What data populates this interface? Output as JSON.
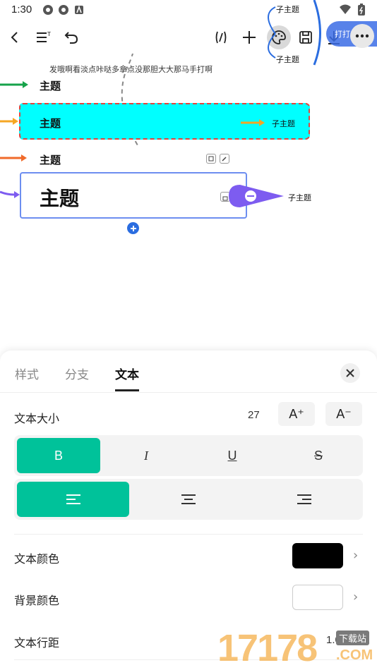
{
  "status": {
    "time": "1:30"
  },
  "toolbar": {
    "share_label": "打打"
  },
  "canvas": {
    "note_text": "发哦啊看淡点咔哒多拿点没那胆大大那马手打啊",
    "topic1": "主题",
    "topic2": "主题",
    "topic2_sub": "子主题",
    "topic3": "主题",
    "topic4": "主题",
    "topic4_sub": "子主题",
    "top_sub1": "子主题",
    "top_sub2": "子主题",
    "colors": {
      "selected_bg": "#00ffff",
      "selected_border": "#e0443c",
      "accent_blue": "#2b6de0",
      "accent_purple": "#7d5cf0",
      "green": "#16a34a",
      "orange": "#f5a623",
      "orange2": "#f06a2a"
    }
  },
  "panel": {
    "tabs": [
      "样式",
      "分支",
      "文本"
    ],
    "active_tab": "文本",
    "text_size_label": "文本大小",
    "text_size_value": "27",
    "size_up": "A⁺",
    "size_down": "A⁻",
    "style_buttons": {
      "bold": "B",
      "italic": "I",
      "underline": "U",
      "strike": "S"
    },
    "text_color_label": "文本颜色",
    "text_color": "#000000",
    "bg_color_label": "背景颜色",
    "bg_color": "#ffffff",
    "line_spacing_label": "文本行距",
    "line_spacing_value": "1.0",
    "accent": "#00c29a"
  },
  "watermark": {
    "number": "17178",
    "tag": "下载站",
    "domain": ".COM"
  }
}
